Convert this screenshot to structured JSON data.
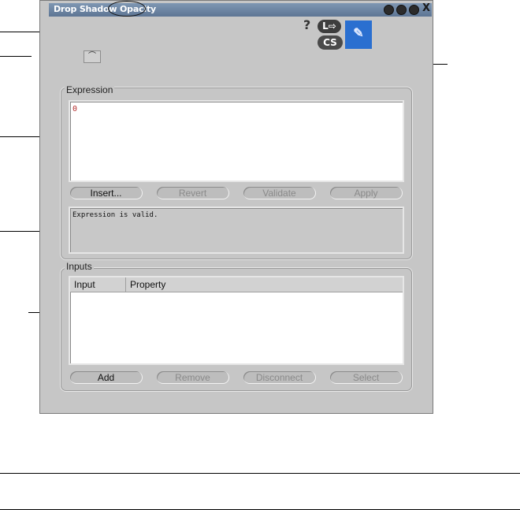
{
  "window": {
    "title": "Drop Shadow Opacity",
    "title_buttons": [
      "eye-icon",
      "globe-icon",
      "info-icon"
    ],
    "close_label": "X"
  },
  "toolbar": {
    "help_label": "?",
    "pill_top_label": "L⇨",
    "pill_bottom_label": "CS",
    "blue_tool_icon": "pencil-icon"
  },
  "expression_group": {
    "label": "Expression",
    "value": "0",
    "buttons": {
      "insert": "Insert...",
      "revert": "Revert",
      "validate": "Validate",
      "apply": "Apply"
    },
    "status": "Expression is valid."
  },
  "inputs_group": {
    "label": "Inputs",
    "columns": [
      "Input",
      "Property"
    ],
    "buttons": {
      "add": "Add",
      "remove": "Remove",
      "disconnect": "Disconnect",
      "select": "Select"
    }
  }
}
